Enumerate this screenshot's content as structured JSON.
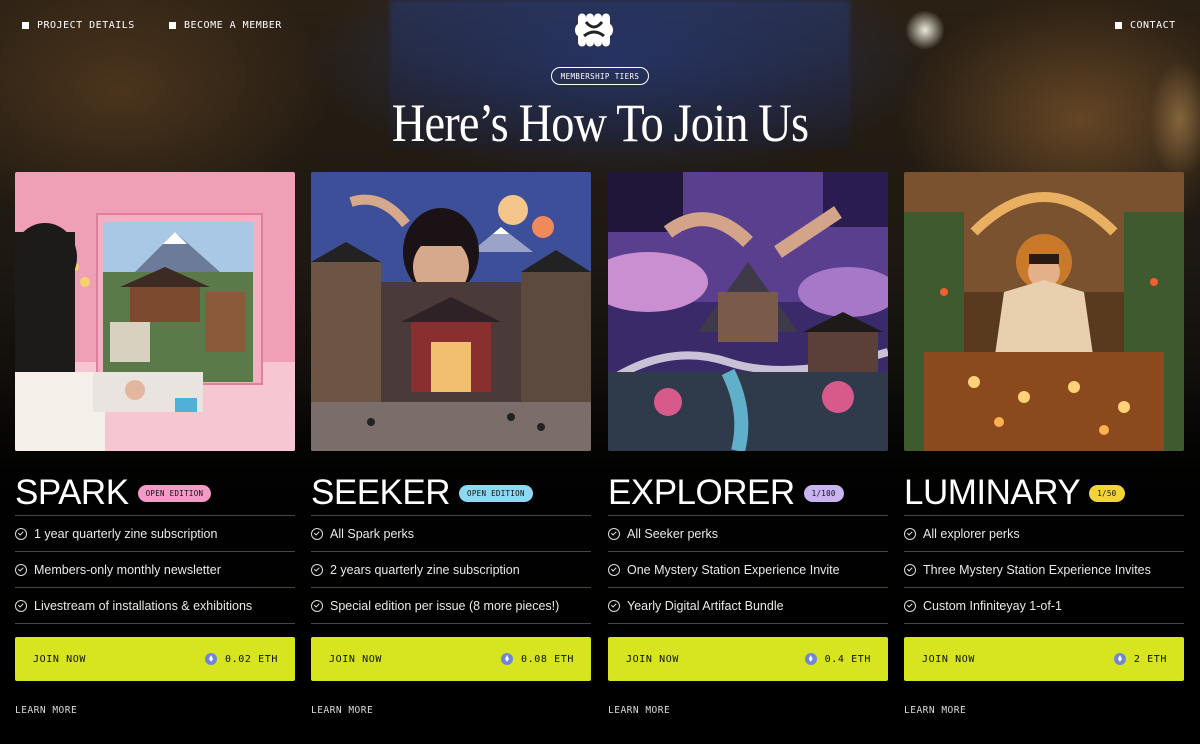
{
  "nav": {
    "left": [
      {
        "label": "PROJECT DETAILS"
      },
      {
        "label": "BECOME A MEMBER"
      }
    ],
    "right": {
      "label": "CONTACT"
    }
  },
  "hero": {
    "pill": "MEMBERSHIP TIERS",
    "title": "Here’s How To Join Us"
  },
  "tiers": [
    {
      "name": "SPARK",
      "badge": "OPEN EDITION",
      "badge_color": "#f29bc7",
      "perks": [
        "1 year quarterly zine subscription",
        "Members-only monthly newsletter",
        "Livestream of installations & exhibitions"
      ],
      "join_label": "JOIN NOW",
      "price": "0.02 ETH",
      "learn_more": "LEARN MORE"
    },
    {
      "name": "SEEKER",
      "badge": "OPEN EDITION",
      "badge_color": "#8fd8f2",
      "perks": [
        "All Spark perks",
        "2 years quarterly zine subscription",
        "Special edition per issue (8 more pieces!)"
      ],
      "join_label": "JOIN NOW",
      "price": "0.08 ETH",
      "learn_more": "LEARN MORE"
    },
    {
      "name": "EXPLORER",
      "badge": "1/100",
      "badge_color": "#c9b3f0",
      "perks": [
        "All Seeker perks",
        "One Mystery Station Experience Invite",
        "Yearly Digital Artifact Bundle"
      ],
      "join_label": "JOIN NOW",
      "price": "0.4 ETH",
      "learn_more": "LEARN MORE"
    },
    {
      "name": "LUMINARY",
      "badge": "1/50",
      "badge_color": "#f2d33a",
      "perks": [
        "All explorer perks",
        "Three Mystery Station Experience Invites",
        "Custom Infiniteyay 1-of-1"
      ],
      "join_label": "JOIN NOW",
      "price": "2 ETH",
      "learn_more": "LEARN MORE"
    }
  ],
  "colors": {
    "accent": "#d6e51f",
    "background": "#000000"
  }
}
